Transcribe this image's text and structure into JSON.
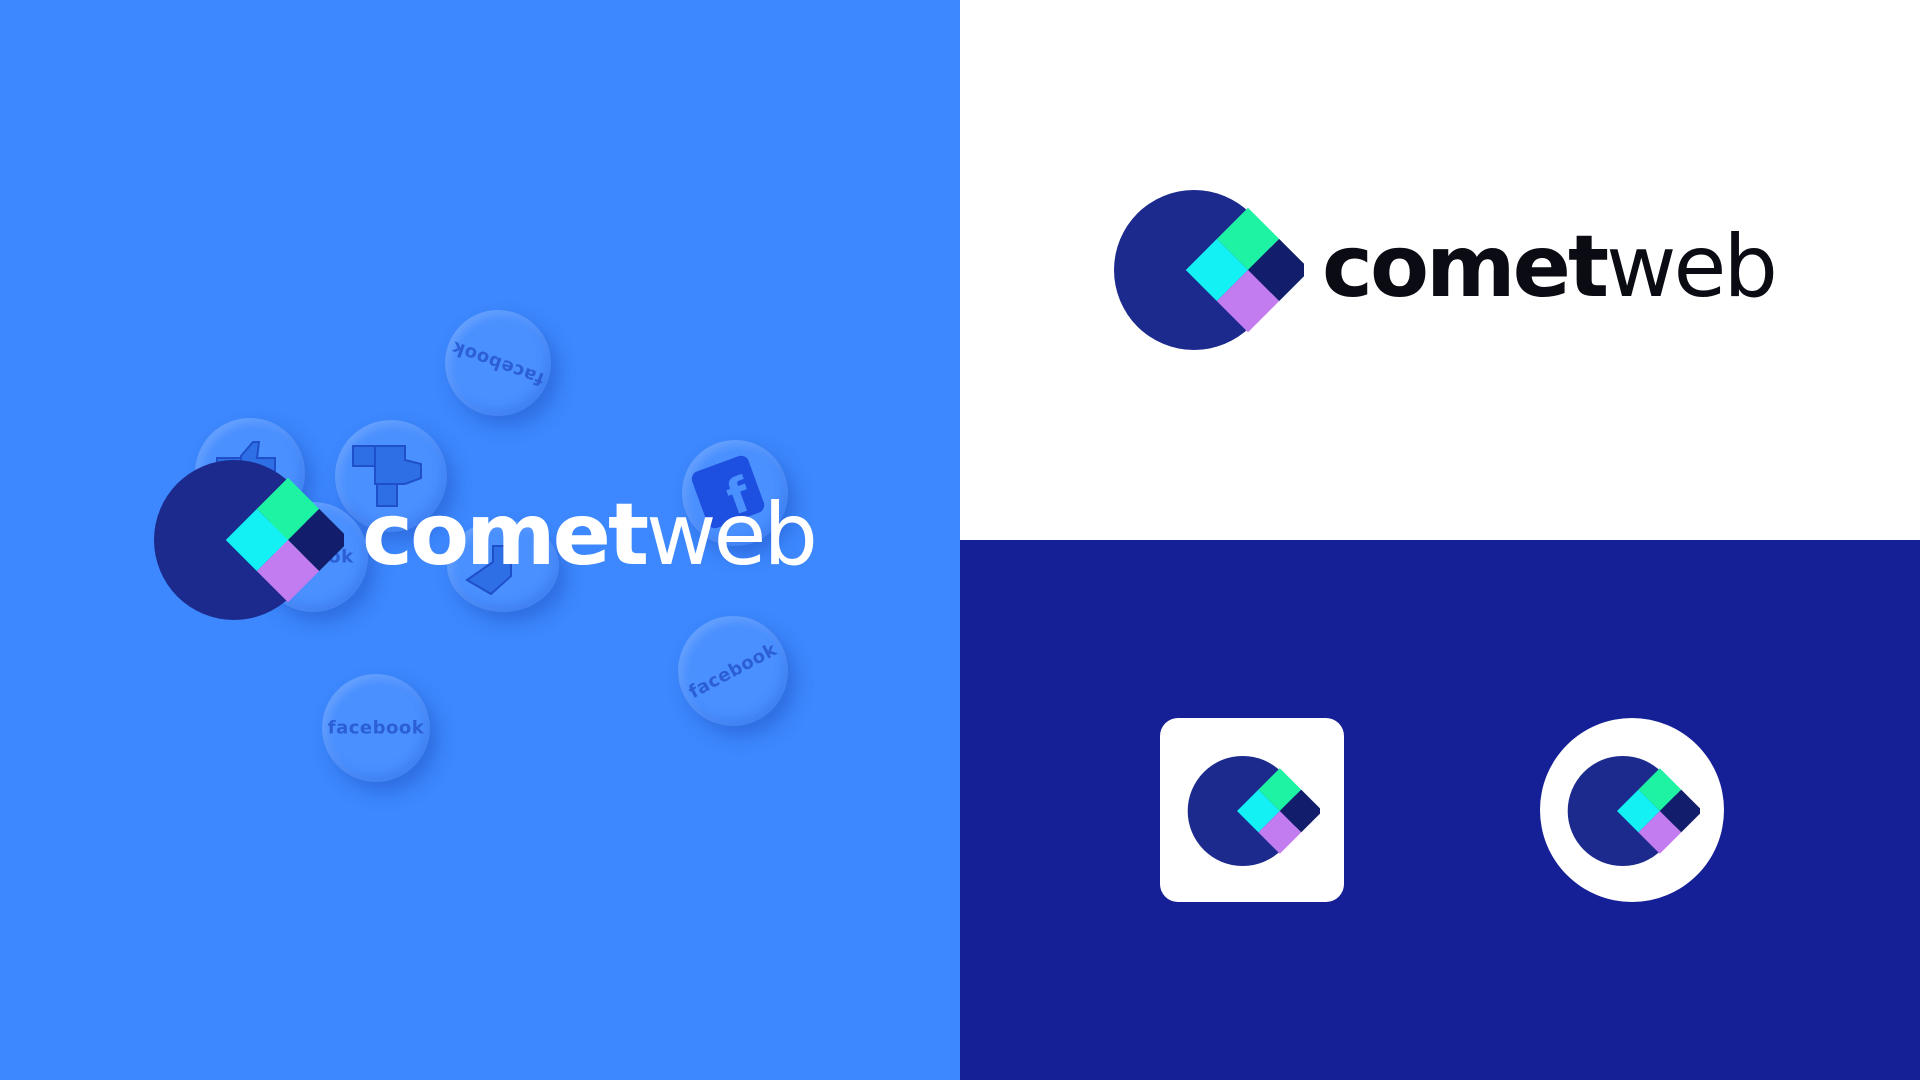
{
  "brand": {
    "name_bold": "comet",
    "name_light": "web"
  },
  "badges": {
    "label": "facebook",
    "label_partial": "book"
  },
  "colors": {
    "left_bg": "#3d88fe",
    "top_right_bg": "#ffffff",
    "bottom_right_bg": "#151f96",
    "logo_navy": "#1b2a8c",
    "logo_green": "#1ef2a3",
    "logo_cyan": "#13f1f5",
    "logo_purple": "#c37bf0",
    "logo_dark": "#121d6b",
    "wordmark_dark": "#0b0b14",
    "wordmark_light": "#ffffff"
  },
  "icons": [
    "cometweb-logo-icon",
    "facebook-like-icon",
    "facebook-f-icon",
    "app-icon-rounded-square",
    "app-icon-circle"
  ]
}
